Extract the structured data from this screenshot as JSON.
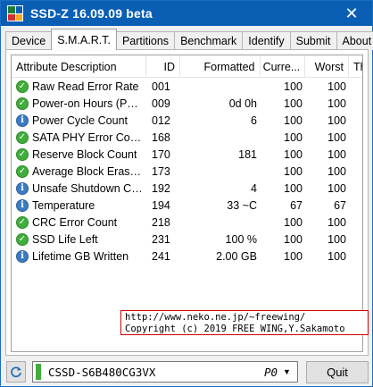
{
  "window": {
    "title": "SSD-Z 16.09.09 beta",
    "close_glyph": "✕"
  },
  "tabs": [
    {
      "label": "Device"
    },
    {
      "label": "S.M.A.R.T.",
      "active": true
    },
    {
      "label": "Partitions"
    },
    {
      "label": "Benchmark"
    },
    {
      "label": "Identify"
    },
    {
      "label": "Submit"
    },
    {
      "label": "About"
    }
  ],
  "smart": {
    "columns": {
      "attr": "Attribute Description",
      "id": "ID",
      "formatted": "Formatted",
      "current": "Curre...",
      "worst": "Worst",
      "threshold": "Thre"
    },
    "rows": [
      {
        "icon": "ok",
        "attr": "Raw Read Error Rate",
        "id": "001",
        "formatted": "",
        "current": "100",
        "worst": "100"
      },
      {
        "icon": "ok",
        "attr": "Power-on Hours (POH)",
        "id": "009",
        "formatted": "0d 0h",
        "current": "100",
        "worst": "100"
      },
      {
        "icon": "info",
        "attr": "Power Cycle Count",
        "id": "012",
        "formatted": "6",
        "current": "100",
        "worst": "100"
      },
      {
        "icon": "ok",
        "attr": "SATA PHY Error Count",
        "id": "168",
        "formatted": "",
        "current": "100",
        "worst": "100"
      },
      {
        "icon": "ok",
        "attr": "Reserve Block Count",
        "id": "170",
        "formatted": "181",
        "current": "100",
        "worst": "100"
      },
      {
        "icon": "ok",
        "attr": "Average Block Erase Co...",
        "id": "173",
        "formatted": "",
        "current": "100",
        "worst": "100"
      },
      {
        "icon": "info",
        "attr": "Unsafe Shutdown Cou...",
        "id": "192",
        "formatted": "4",
        "current": "100",
        "worst": "100"
      },
      {
        "icon": "info",
        "attr": "Temperature",
        "id": "194",
        "formatted": "33 ~C",
        "current": "67",
        "worst": "67"
      },
      {
        "icon": "ok",
        "attr": "CRC Error Count",
        "id": "218",
        "formatted": "",
        "current": "100",
        "worst": "100"
      },
      {
        "icon": "ok",
        "attr": "SSD Life Left",
        "id": "231",
        "formatted": "100 %",
        "current": "100",
        "worst": "100"
      },
      {
        "icon": "info",
        "attr": "Lifetime GB Written",
        "id": "241",
        "formatted": "2.00 GB",
        "current": "100",
        "worst": "100"
      }
    ]
  },
  "overlay": {
    "line1": "http://www.neko.ne.jp/~freewing/",
    "line2": "Copyright (c) 2019 FREE WING,Y.Sakamoto"
  },
  "bottom": {
    "drive_name": "CSSD-S6B480CG3VX",
    "drive_port": "P0",
    "quit_label": "Quit"
  },
  "colors": {
    "titlebar": "#0a5fb5",
    "ok_icon": "#3fae3a",
    "info_icon": "#3a7cc4",
    "overlay_border": "#d00000"
  }
}
